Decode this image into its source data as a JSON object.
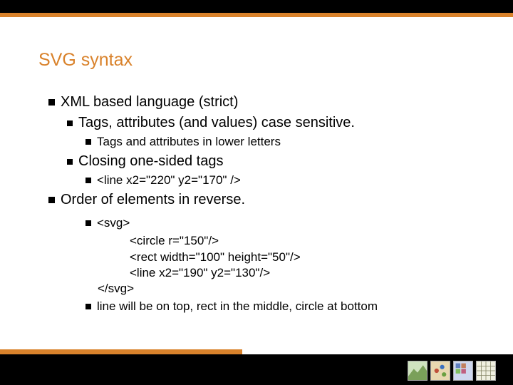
{
  "title": "SVG syntax",
  "bullets": {
    "l1": "XML based language (strict)",
    "l2a": "Tags, attributes (and values) case sensitive.",
    "l3a": "Tags and attributes in lower letters",
    "l2b": "Closing one-sided tags",
    "l3b": "<line x2=\"220\" y2=\"170\" />",
    "l1b": "Order of elements in reverse.",
    "l3c": "<svg>",
    "l4a": "<circle r=\"150\"/>",
    "l4b": "<rect width=\"100\" height=\"50\"/>",
    "l4c": "<line x2=\"190\" y2=\"130\"/>",
    "l3d": "</svg>",
    "l3e": "line will be on top, rect in the middle, circle at bottom"
  }
}
